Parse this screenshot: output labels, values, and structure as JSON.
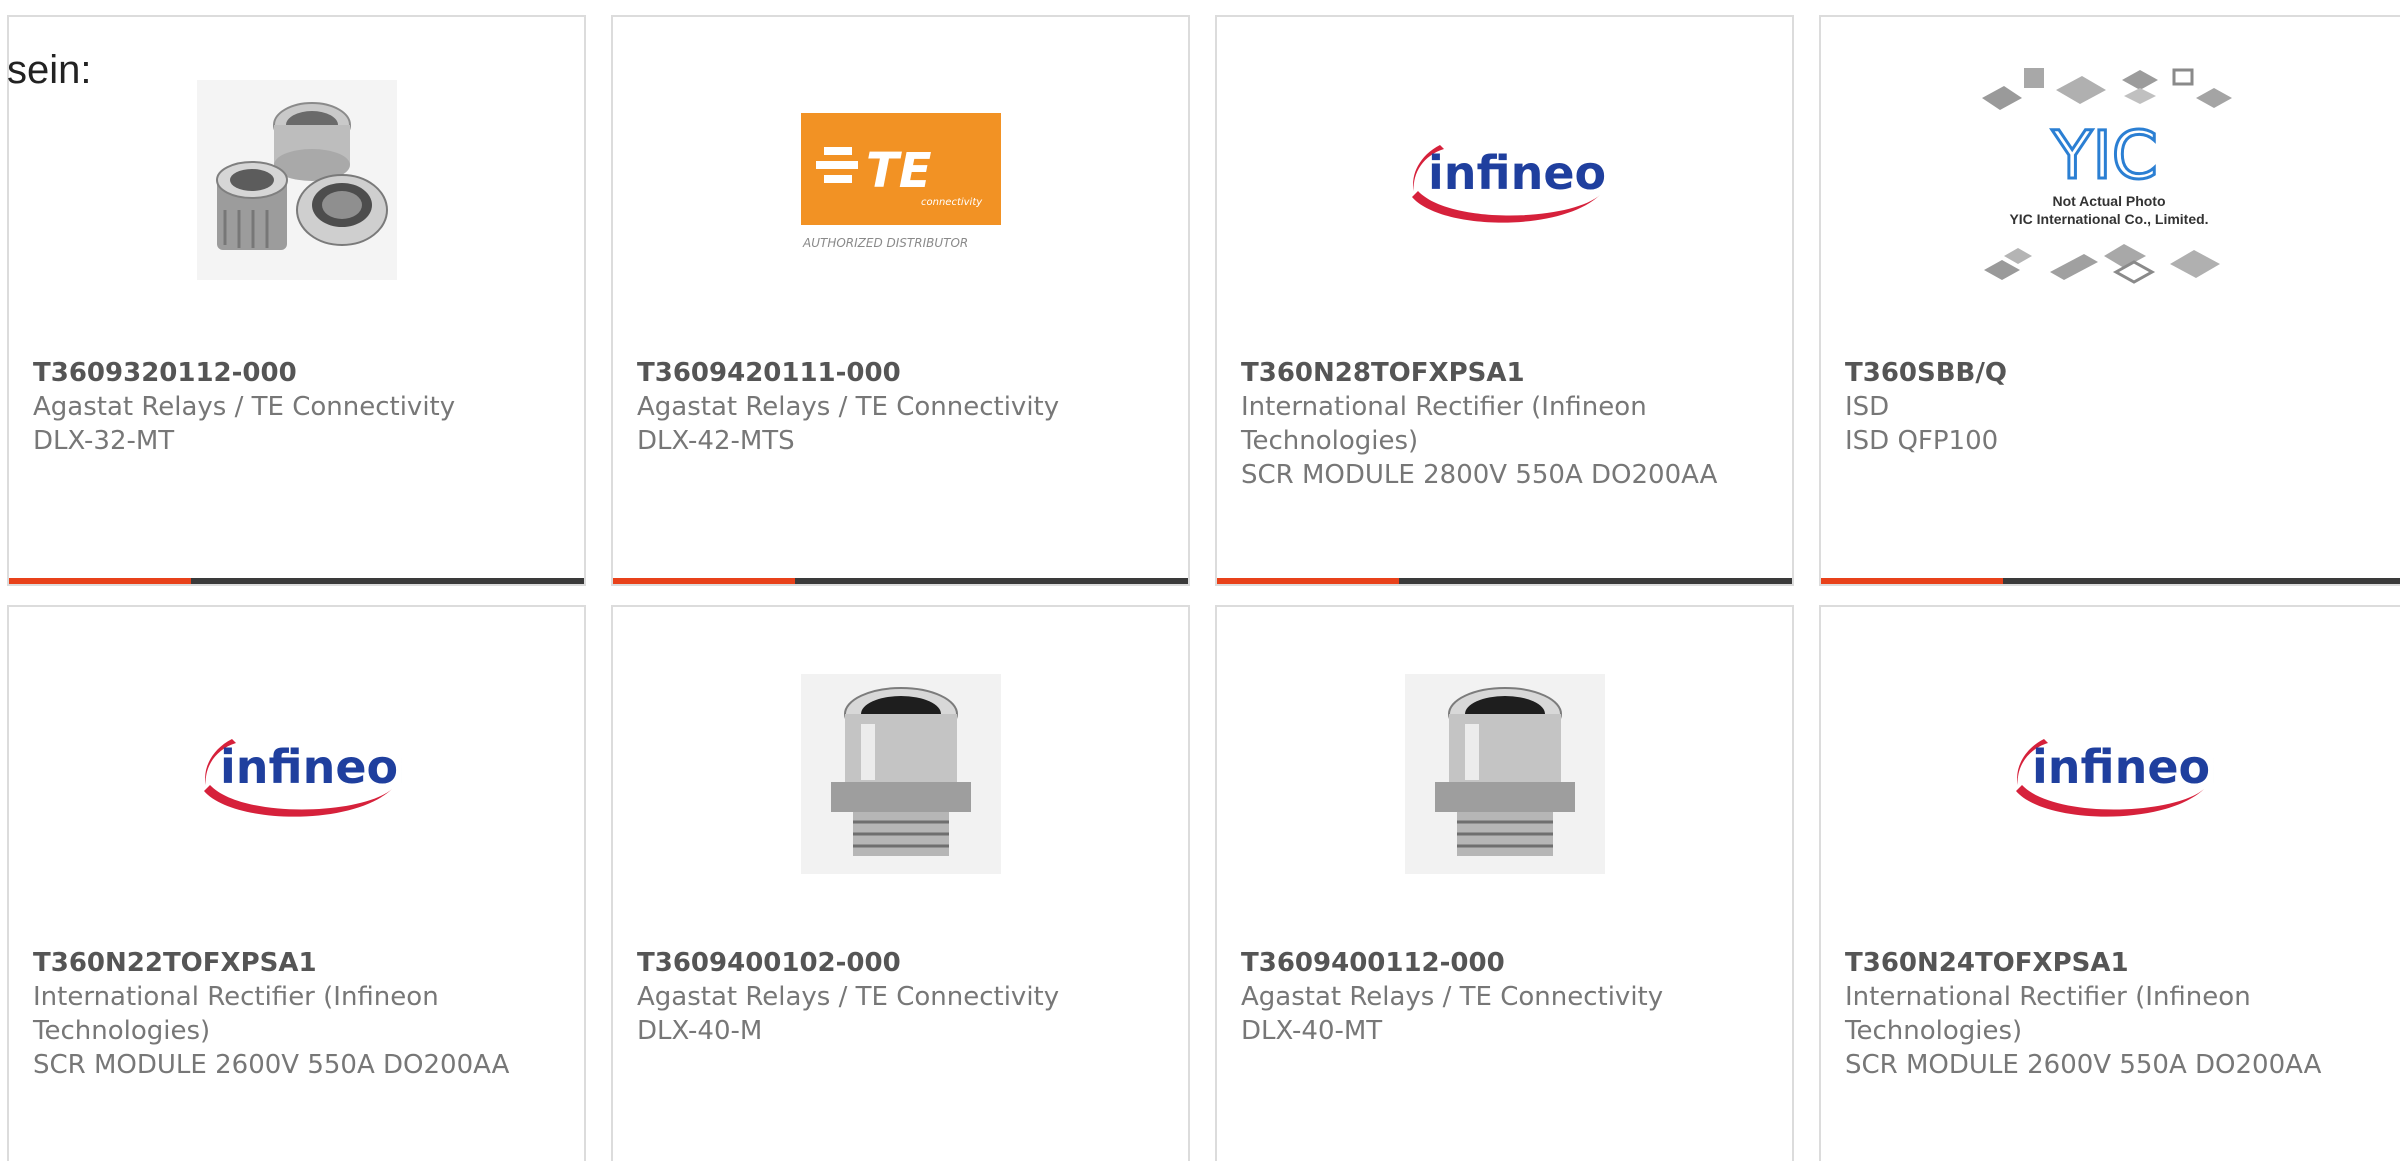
{
  "intro_text": "sein:",
  "colors": {
    "accent_bar": "#e8411a",
    "bar_dark": "#3a3a3a",
    "te_orange": "#f29224",
    "infineon_blue": "#1f3f9e",
    "infineon_red": "#d6213b",
    "yic_blue": "#2b7fd3"
  },
  "logos": {
    "te_brand": "TE",
    "te_sub": "connectivity",
    "te_tag": "AUTHORIZED DISTRIBUTOR",
    "infineon_wordmark": "infineon",
    "yic_wordmark": "YIC",
    "yic_note_1": "Not Actual Photo",
    "yic_note_2": "YIC International Co., Limited."
  },
  "products": [
    {
      "part_number": "T3609320112-000",
      "manufacturer": "Agastat Relays / TE Connectivity",
      "description": "DLX-32-MT",
      "image": "gland-set-photo"
    },
    {
      "part_number": "T3609420111-000",
      "manufacturer": "Agastat Relays / TE Connectivity",
      "description": "DLX-42-MTS",
      "image": "te-connectivity-logo"
    },
    {
      "part_number": "T360N28TOFXPSA1",
      "manufacturer": "International Rectifier (Infineon Technologies)",
      "description": "SCR MODULE 2800V 550A DO200AA",
      "image": "infineon-logo"
    },
    {
      "part_number": "T360SBB/Q",
      "manufacturer": "ISD",
      "description": "ISD QFP100",
      "image": "yic-placeholder"
    },
    {
      "part_number": "T360N22TOFXPSA1",
      "manufacturer": "International Rectifier (Infineon Technologies)",
      "description": "SCR MODULE 2600V 550A DO200AA",
      "image": "infineon-logo"
    },
    {
      "part_number": "T3609400102-000",
      "manufacturer": "Agastat Relays / TE Connectivity",
      "description": "DLX-40-M",
      "image": "cable-gland-photo"
    },
    {
      "part_number": "T3609400112-000",
      "manufacturer": "Agastat Relays / TE Connectivity",
      "description": "DLX-40-MT",
      "image": "cable-gland-photo"
    },
    {
      "part_number": "T360N24TOFXPSA1",
      "manufacturer": "International Rectifier (Infineon Technologies)",
      "description": "SCR MODULE 2600V 550A DO200AA",
      "image": "infineon-logo"
    }
  ]
}
